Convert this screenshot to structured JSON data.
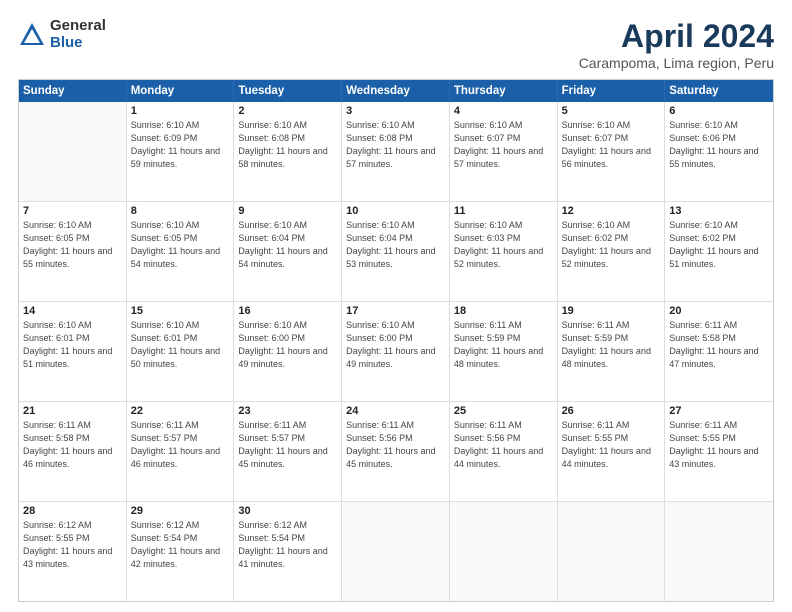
{
  "header": {
    "logo_general": "General",
    "logo_blue": "Blue",
    "title": "April 2024",
    "location": "Carampoma, Lima region, Peru"
  },
  "weekdays": [
    "Sunday",
    "Monday",
    "Tuesday",
    "Wednesday",
    "Thursday",
    "Friday",
    "Saturday"
  ],
  "weeks": [
    [
      {
        "day": "",
        "empty": true
      },
      {
        "day": "1",
        "sunrise": "Sunrise: 6:10 AM",
        "sunset": "Sunset: 6:09 PM",
        "daylight": "Daylight: 11 hours and 59 minutes."
      },
      {
        "day": "2",
        "sunrise": "Sunrise: 6:10 AM",
        "sunset": "Sunset: 6:08 PM",
        "daylight": "Daylight: 11 hours and 58 minutes."
      },
      {
        "day": "3",
        "sunrise": "Sunrise: 6:10 AM",
        "sunset": "Sunset: 6:08 PM",
        "daylight": "Daylight: 11 hours and 57 minutes."
      },
      {
        "day": "4",
        "sunrise": "Sunrise: 6:10 AM",
        "sunset": "Sunset: 6:07 PM",
        "daylight": "Daylight: 11 hours and 57 minutes."
      },
      {
        "day": "5",
        "sunrise": "Sunrise: 6:10 AM",
        "sunset": "Sunset: 6:07 PM",
        "daylight": "Daylight: 11 hours and 56 minutes."
      },
      {
        "day": "6",
        "sunrise": "Sunrise: 6:10 AM",
        "sunset": "Sunset: 6:06 PM",
        "daylight": "Daylight: 11 hours and 55 minutes."
      }
    ],
    [
      {
        "day": "7",
        "sunrise": "Sunrise: 6:10 AM",
        "sunset": "Sunset: 6:05 PM",
        "daylight": "Daylight: 11 hours and 55 minutes."
      },
      {
        "day": "8",
        "sunrise": "Sunrise: 6:10 AM",
        "sunset": "Sunset: 6:05 PM",
        "daylight": "Daylight: 11 hours and 54 minutes."
      },
      {
        "day": "9",
        "sunrise": "Sunrise: 6:10 AM",
        "sunset": "Sunset: 6:04 PM",
        "daylight": "Daylight: 11 hours and 54 minutes."
      },
      {
        "day": "10",
        "sunrise": "Sunrise: 6:10 AM",
        "sunset": "Sunset: 6:04 PM",
        "daylight": "Daylight: 11 hours and 53 minutes."
      },
      {
        "day": "11",
        "sunrise": "Sunrise: 6:10 AM",
        "sunset": "Sunset: 6:03 PM",
        "daylight": "Daylight: 11 hours and 52 minutes."
      },
      {
        "day": "12",
        "sunrise": "Sunrise: 6:10 AM",
        "sunset": "Sunset: 6:02 PM",
        "daylight": "Daylight: 11 hours and 52 minutes."
      },
      {
        "day": "13",
        "sunrise": "Sunrise: 6:10 AM",
        "sunset": "Sunset: 6:02 PM",
        "daylight": "Daylight: 11 hours and 51 minutes."
      }
    ],
    [
      {
        "day": "14",
        "sunrise": "Sunrise: 6:10 AM",
        "sunset": "Sunset: 6:01 PM",
        "daylight": "Daylight: 11 hours and 51 minutes."
      },
      {
        "day": "15",
        "sunrise": "Sunrise: 6:10 AM",
        "sunset": "Sunset: 6:01 PM",
        "daylight": "Daylight: 11 hours and 50 minutes."
      },
      {
        "day": "16",
        "sunrise": "Sunrise: 6:10 AM",
        "sunset": "Sunset: 6:00 PM",
        "daylight": "Daylight: 11 hours and 49 minutes."
      },
      {
        "day": "17",
        "sunrise": "Sunrise: 6:10 AM",
        "sunset": "Sunset: 6:00 PM",
        "daylight": "Daylight: 11 hours and 49 minutes."
      },
      {
        "day": "18",
        "sunrise": "Sunrise: 6:11 AM",
        "sunset": "Sunset: 5:59 PM",
        "daylight": "Daylight: 11 hours and 48 minutes."
      },
      {
        "day": "19",
        "sunrise": "Sunrise: 6:11 AM",
        "sunset": "Sunset: 5:59 PM",
        "daylight": "Daylight: 11 hours and 48 minutes."
      },
      {
        "day": "20",
        "sunrise": "Sunrise: 6:11 AM",
        "sunset": "Sunset: 5:58 PM",
        "daylight": "Daylight: 11 hours and 47 minutes."
      }
    ],
    [
      {
        "day": "21",
        "sunrise": "Sunrise: 6:11 AM",
        "sunset": "Sunset: 5:58 PM",
        "daylight": "Daylight: 11 hours and 46 minutes."
      },
      {
        "day": "22",
        "sunrise": "Sunrise: 6:11 AM",
        "sunset": "Sunset: 5:57 PM",
        "daylight": "Daylight: 11 hours and 46 minutes."
      },
      {
        "day": "23",
        "sunrise": "Sunrise: 6:11 AM",
        "sunset": "Sunset: 5:57 PM",
        "daylight": "Daylight: 11 hours and 45 minutes."
      },
      {
        "day": "24",
        "sunrise": "Sunrise: 6:11 AM",
        "sunset": "Sunset: 5:56 PM",
        "daylight": "Daylight: 11 hours and 45 minutes."
      },
      {
        "day": "25",
        "sunrise": "Sunrise: 6:11 AM",
        "sunset": "Sunset: 5:56 PM",
        "daylight": "Daylight: 11 hours and 44 minutes."
      },
      {
        "day": "26",
        "sunrise": "Sunrise: 6:11 AM",
        "sunset": "Sunset: 5:55 PM",
        "daylight": "Daylight: 11 hours and 44 minutes."
      },
      {
        "day": "27",
        "sunrise": "Sunrise: 6:11 AM",
        "sunset": "Sunset: 5:55 PM",
        "daylight": "Daylight: 11 hours and 43 minutes."
      }
    ],
    [
      {
        "day": "28",
        "sunrise": "Sunrise: 6:12 AM",
        "sunset": "Sunset: 5:55 PM",
        "daylight": "Daylight: 11 hours and 43 minutes."
      },
      {
        "day": "29",
        "sunrise": "Sunrise: 6:12 AM",
        "sunset": "Sunset: 5:54 PM",
        "daylight": "Daylight: 11 hours and 42 minutes."
      },
      {
        "day": "30",
        "sunrise": "Sunrise: 6:12 AM",
        "sunset": "Sunset: 5:54 PM",
        "daylight": "Daylight: 11 hours and 41 minutes."
      },
      {
        "day": "",
        "empty": true
      },
      {
        "day": "",
        "empty": true
      },
      {
        "day": "",
        "empty": true
      },
      {
        "day": "",
        "empty": true
      }
    ]
  ]
}
